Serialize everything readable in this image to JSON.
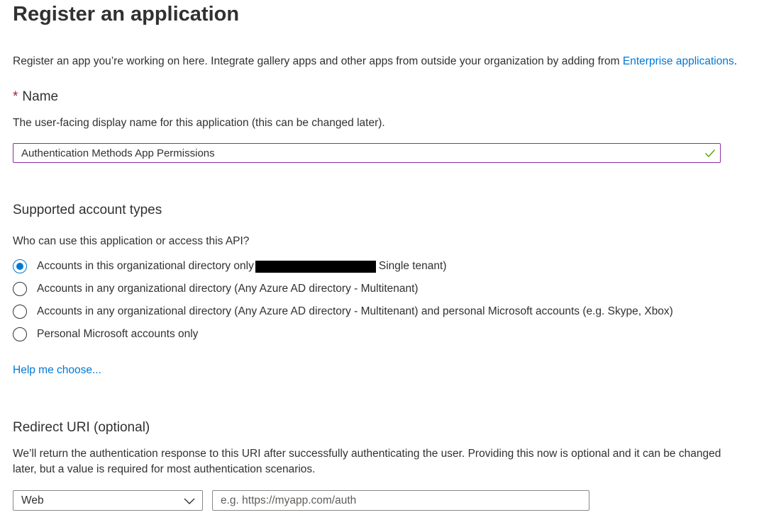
{
  "page": {
    "title": "Register an application",
    "intro_text": "Register an app you’re working on here. Integrate gallery apps and other apps from outside your organization by adding from ",
    "intro_link": "Enterprise applications",
    "intro_suffix": "."
  },
  "name_section": {
    "required_marker": "*",
    "heading": "Name",
    "description": "The user-facing display name for this application (this can be changed later).",
    "value": "Authentication Methods App Permissions",
    "valid_icon": "checkmark-icon"
  },
  "account_types": {
    "heading": "Supported account types",
    "question": "Who can use this application or access this API?",
    "options": [
      {
        "label_prefix": "Accounts in this organizational directory only",
        "label_suffix": "Single tenant)",
        "selected": true
      },
      {
        "label": "Accounts in any organizational directory (Any Azure AD directory - Multitenant)",
        "selected": false
      },
      {
        "label": "Accounts in any organizational directory (Any Azure AD directory - Multitenant) and personal Microsoft accounts (e.g. Skype, Xbox)",
        "selected": false
      },
      {
        "label": "Personal Microsoft accounts only",
        "selected": false
      }
    ],
    "help_link": "Help me choose..."
  },
  "redirect": {
    "heading": "Redirect URI (optional)",
    "description": "We’ll return the authentication response to this URI after successfully authenticating the user. Providing this now is optional and it can be changed later, but a value is required for most authentication scenarios.",
    "platform_value": "Web",
    "uri_placeholder": "e.g. https://myapp.com/auth",
    "uri_value": ""
  },
  "colors": {
    "accent": "#0078d4",
    "text": "#323130",
    "required": "#a4262c",
    "valid_check": "#57a300",
    "focused_border": "#8a2da5"
  }
}
